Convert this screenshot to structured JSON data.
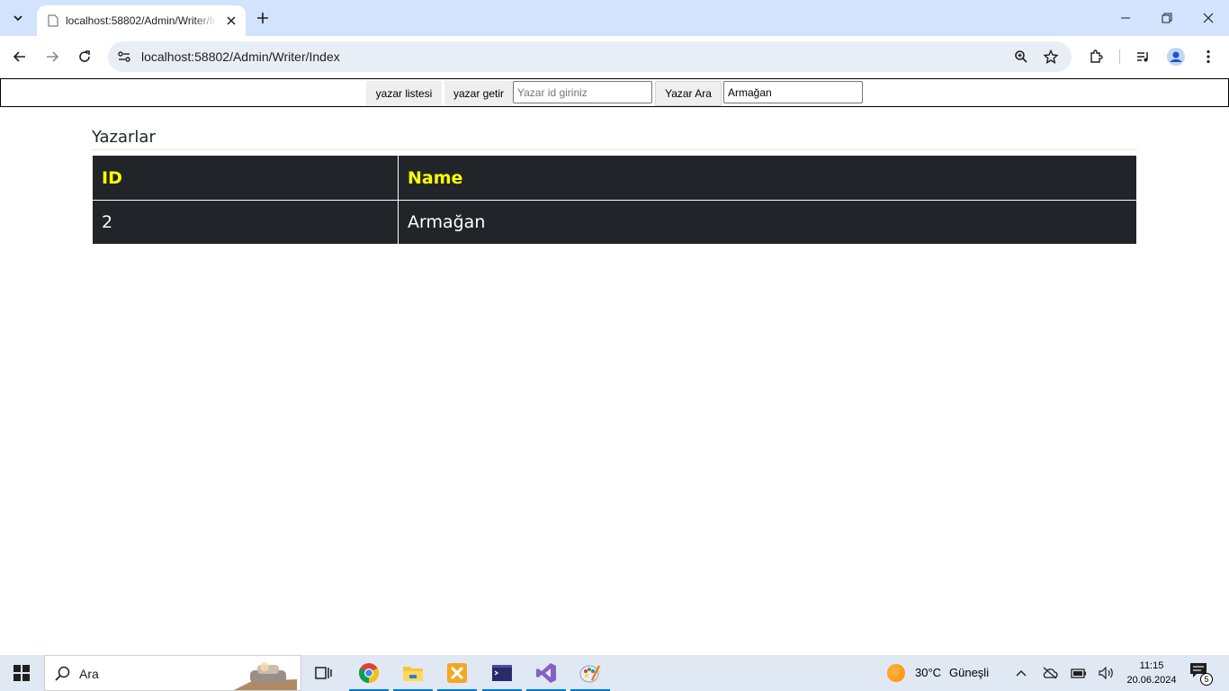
{
  "browser": {
    "tab_title": "localhost:58802/Admin/Writer/Index",
    "url": "localhost:58802/Admin/Writer/Index"
  },
  "form": {
    "list_button": "yazar listesi",
    "get_button": "yazar getir",
    "id_input_placeholder": "Yazar id giriniz",
    "id_input_value": "",
    "search_button": "Yazar Ara",
    "search_input_value": "Armağan"
  },
  "main": {
    "title": "Yazarlar",
    "table": {
      "headers": [
        "ID",
        "Name"
      ],
      "rows": [
        {
          "id": "2",
          "name": "Armağan"
        }
      ]
    },
    "header_color": "#ffff00",
    "table_bg": "#212529"
  },
  "taskbar": {
    "search_text": "Ara",
    "weather_temp": "30°C",
    "weather_desc": "Güneşli",
    "time": "11:15",
    "date": "20.06.2024",
    "notification_count": "5",
    "apps": [
      "chrome-icon",
      "file-explorer-icon",
      "xampp-icon",
      "terminal-icon",
      "visual-studio-icon",
      "paint-icon"
    ]
  }
}
